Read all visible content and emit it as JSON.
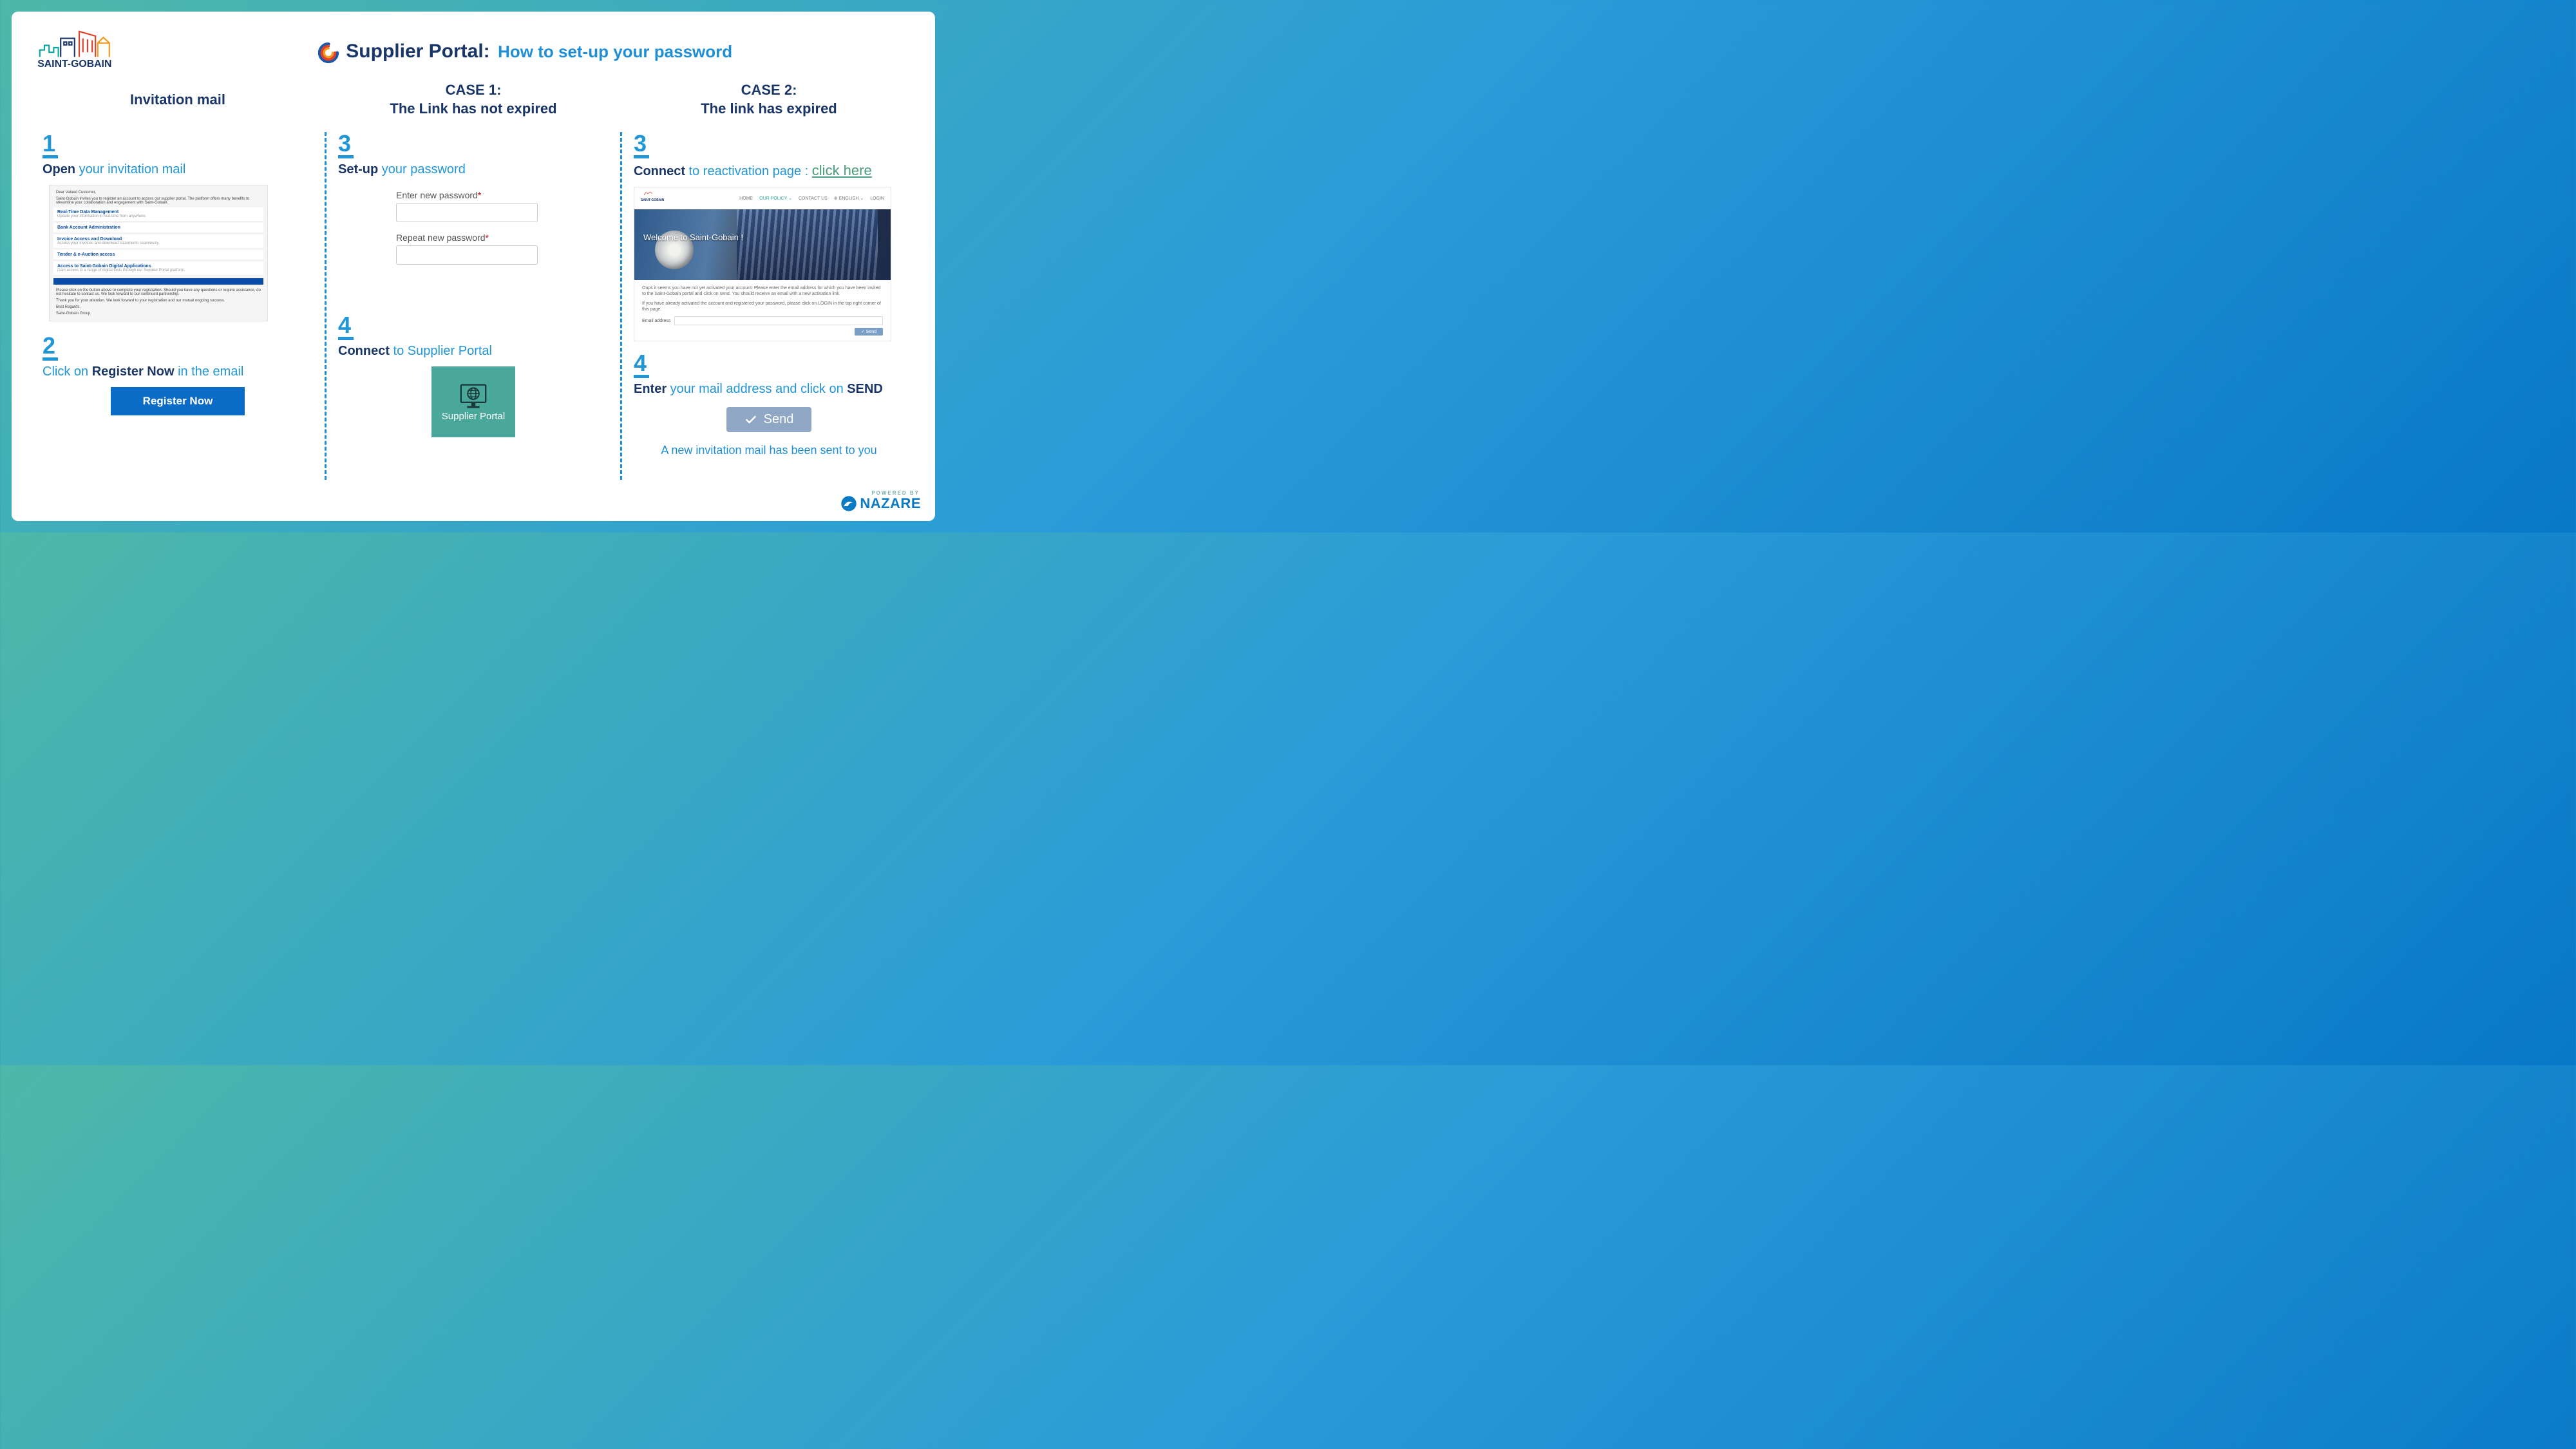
{
  "brand": "SAINT-GOBAIN",
  "title": {
    "main": "Supplier Portal:",
    "sub": "How to set-up your password"
  },
  "col1": {
    "heading": "Invitation mail",
    "step1": {
      "num": "1",
      "bold": "Open",
      "rest": " your invitation mail"
    },
    "email": {
      "greet1": "Dear Valued Customer,",
      "greet2": "Saint-Gobain invites you to register an account to access our supplier portal. The platform offers many benefits to streamline your collaboration and engagement with Saint-Gobain.",
      "rows": [
        {
          "t": "Real-Time Data Management",
          "s": "Update your information in real-time from anywhere."
        },
        {
          "t": "Bank Account Administration",
          "s": ""
        },
        {
          "t": "Invoice Access and Download",
          "s": "Access your invoices and download statements seamlessly."
        },
        {
          "t": "Tender & e-Auction access",
          "s": ""
        },
        {
          "t": "Access to Saint-Gobain Digital Applications",
          "s": "Gain access to a range of digital tools through our Supplier Portal platform."
        }
      ],
      "bar": "Register Now",
      "foot1": "Please click on the button above to complete your registration. Should you have any questions or require assistance, do not hesitate to contact us. We look forward to our continued partnership.",
      "foot2": "Thank you for your attention. We look forward to your registration and our mutual ongoing success.",
      "sign1": "Best Regards,",
      "sign2": "Saint-Gobain Group"
    },
    "step2": {
      "num": "2",
      "pre": "Click on ",
      "bold": "Register Now",
      "post": " in the email",
      "btn": "Register Now"
    }
  },
  "col2": {
    "heading1": "CASE 1:",
    "heading2": "The Link has not expired",
    "step3": {
      "num": "3",
      "bold": "Set-up",
      "rest": " your password",
      "label1": "Enter new password",
      "label2": "Repeat new password"
    },
    "step4": {
      "num": "4",
      "bold": "Connect",
      "rest": " to Supplier Portal",
      "tile": "Supplier Portal"
    }
  },
  "col3": {
    "heading1": "CASE 2:",
    "heading2": "The link has expired",
    "step3": {
      "num": "3",
      "bold": "Connect",
      "rest": " to reactivation page : ",
      "link": "click here"
    },
    "react": {
      "nav": [
        "HOME",
        "OUR POLICY ⌄",
        "CONTACT US",
        "⊕ ENGLISH ⌄",
        "LOGIN"
      ],
      "welcome": "Welcome to Saint-Gobain !",
      "p1": "Oups it seems you have not yet activated your account. Please enter the email address for which you have been invited to the Saint-Gobain portal and click on send. You should receive an email with a new activation link.",
      "p2": "If you have already activated the account and registered your password, please click on LOGIN in the top right corner of this page.",
      "emaillabel": "Email address",
      "send": "✓ Send"
    },
    "step4": {
      "num": "4",
      "bold": "Enter",
      "mid": " your mail address and click on ",
      "bold2": "SEND",
      "btn": "Send",
      "note": "A new invitation mail has been sent to you"
    }
  },
  "footer": {
    "powered": "POWERED BY",
    "brand": "NAZARE"
  }
}
